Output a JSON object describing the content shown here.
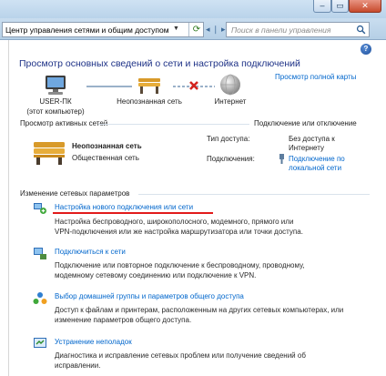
{
  "window": {
    "close_symbol": "✕",
    "min_symbol": "–",
    "max_symbol": "▭"
  },
  "address": {
    "path": "Центр управления сетями и общим доступом",
    "search_placeholder": "Поиск в панели управления",
    "separator": "◂ ❘ ▸"
  },
  "main": {
    "title": "Просмотр основных сведений о сети и настройка подключений",
    "full_map_link": "Просмотр полной карты",
    "nodes": {
      "computer": "USER-ПК",
      "computer_sub": "(этот компьютер)",
      "network": "Неопознанная сеть",
      "internet": "Интернет"
    },
    "active_networks": {
      "title": "Просмотр активных сетей",
      "link": "Подключение или отключение",
      "network_name": "Неопознанная сеть",
      "network_type": "Общественная сеть",
      "access_type_label": "Тип доступа:",
      "access_type_value_1": "Без доступа к",
      "access_type_value_2": "Интернету",
      "connections_label": "Подключения:",
      "connections_link_1": "Подключение по",
      "connections_link_2": "локальной сети"
    },
    "change_settings": {
      "title": "Изменение сетевых параметров",
      "tasks": [
        {
          "title": "Настройка нового подключения или сети",
          "desc": [
            "Настройка беспроводного, широкополосного, модемного, прямого или",
            "VPN-подключения или же настройка маршрутизатора или точки доступа."
          ]
        },
        {
          "title": "Подключиться к сети",
          "desc": [
            "Подключение или повторное подключение к беспроводному, проводному,",
            "модемному сетевому соединению или подключение к VPN."
          ]
        },
        {
          "title": "Выбор домашней группы и параметров общего доступа",
          "desc": [
            "Доступ к файлам и принтерам, расположенным на других сетевых компьютерах, или",
            "изменение параметров общего доступа."
          ]
        },
        {
          "title": "Устранение неполадок",
          "desc": [
            "Диагностика и исправление сетевых проблем или получение сведений об",
            "исправлении."
          ]
        }
      ]
    }
  },
  "colors": {
    "link": "#0066cc",
    "heading": "#1e3287",
    "highlight": "#e21b1b"
  }
}
